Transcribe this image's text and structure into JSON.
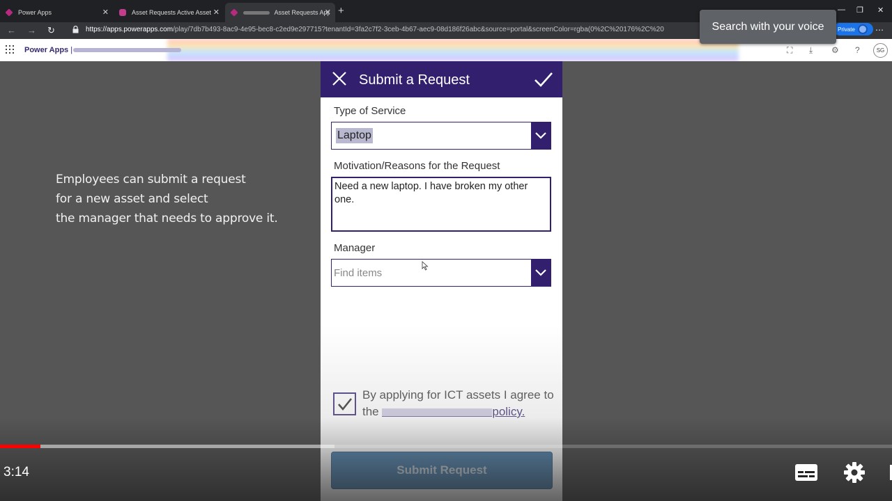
{
  "browser": {
    "tabs": [
      {
        "label": "Power Apps"
      },
      {
        "label": "Asset Requests Active Asset Req"
      },
      {
        "label": "Asset Requests App -"
      }
    ],
    "url_host": "https://apps.powerapps.com",
    "url_rest": "/play/7db7b493-8ac9-4e95-bec8-c2ed9e297715?tenantId=3fa2c7f2-3ceb-4b67-aec9-08d186f26abc&source=portal&screenColor=rgba(0%2C%20176%2C%20",
    "private_label": "Private"
  },
  "tooltip": {
    "text": "Search with your voice"
  },
  "powerapps_bar": {
    "label": "Power Apps",
    "separator": "|",
    "avatar_initials": "SG"
  },
  "caption": {
    "line1": "Employees can submit a request",
    "line2": "for a new asset and select",
    "line3": "the manager that needs to approve it."
  },
  "form": {
    "title": "Submit a Request",
    "service_label": "Type of Service",
    "service_value": "Laptop",
    "motivation_label": "Motivation/Reasons for the Request",
    "motivation_value": "Need a new laptop. I have broken my other one.",
    "manager_label": "Manager",
    "manager_placeholder": "Find items",
    "agree_text": "By applying for ICT assets I agree to the",
    "agree_link": "policy.",
    "agree_checked": true,
    "submit_label": "Submit Request"
  },
  "player": {
    "current_time": "3:14",
    "played_fraction": 0.045,
    "buffered_fraction": 0.375
  }
}
